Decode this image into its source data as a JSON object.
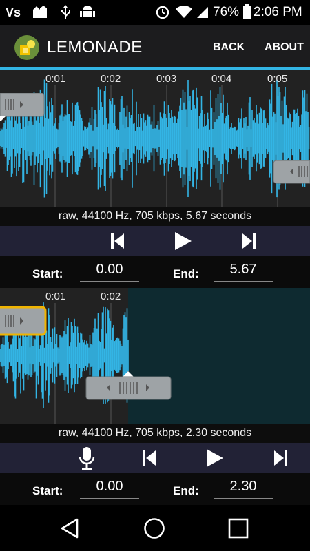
{
  "status_bar": {
    "battery": "76%",
    "time": "2:06 PM",
    "icons": [
      "vs-icon",
      "notification-icon",
      "usb-icon",
      "android-debug-icon",
      "alarm-icon",
      "wifi-icon",
      "signal-icon",
      "battery-icon"
    ]
  },
  "appbar": {
    "title": "LEMONADE",
    "back_label": "BACK",
    "about_label": "ABOUT",
    "accent": "#33b5e5"
  },
  "top_editor": {
    "ticks": [
      "0:01",
      "0:02",
      "0:03",
      "0:04",
      "0:05"
    ],
    "info": "raw, 44100 Hz, 705 kbps, 5.67 seconds",
    "start_label": "Start:",
    "start_value": "0.00",
    "end_label": "End:",
    "end_value": "5.67"
  },
  "bottom_editor": {
    "ticks": [
      "0:01",
      "0:02"
    ],
    "info": "raw, 44100 Hz, 705 kbps, 2.30 seconds",
    "start_label": "Start:",
    "start_value": "0.00",
    "end_label": "End:",
    "end_value": "2.30"
  },
  "colors": {
    "waveform": "#33b5e5",
    "selection_bg": "#222222",
    "unselected_bg": "#0e2a30",
    "handle": "#9ea3a6",
    "handle_focus": "#f0b400"
  }
}
